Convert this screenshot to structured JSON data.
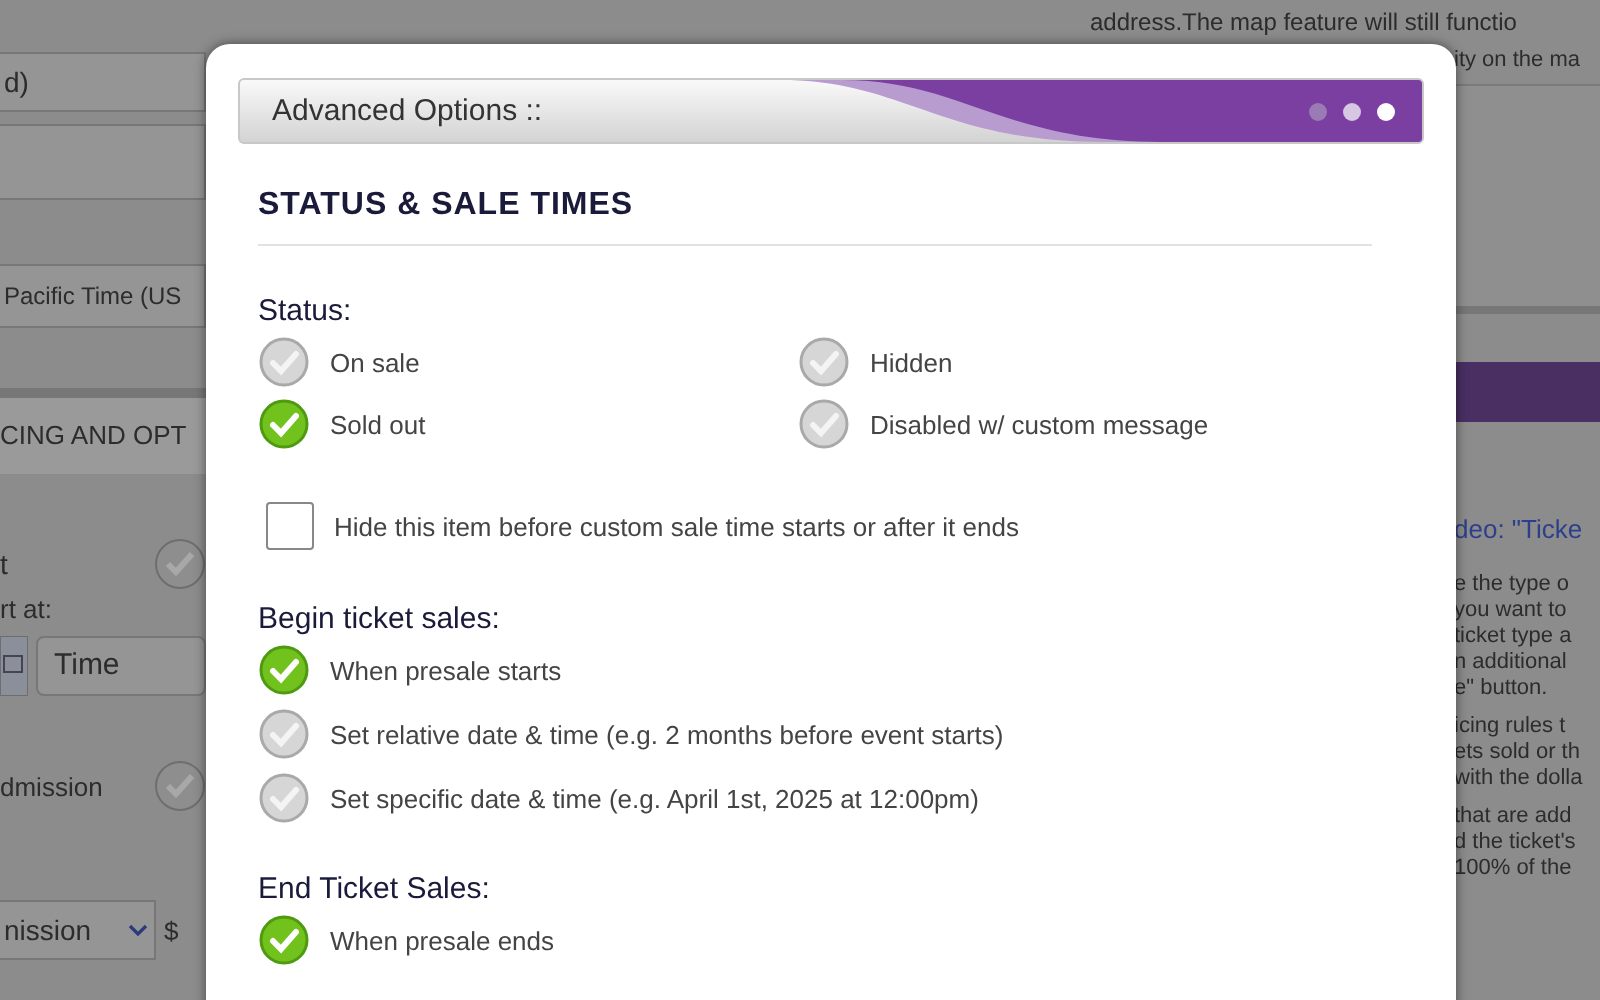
{
  "background": {
    "left": {
      "field_1": "d)",
      "timezone": "Pacific Time (US",
      "section_header": "CING AND OPT",
      "option_1": {
        "label": "t",
        "selected": false
      },
      "start_label": "rt at:",
      "time_field": "Time",
      "option_2": {
        "label": "dmission",
        "selected": false
      },
      "type_select": "nission",
      "currency": "$"
    },
    "right": {
      "top_text": [
        "address.The map feature will still functio"
      ],
      "top_text_tail": "ity on the ma",
      "video_link": "deo: \"Ticke",
      "help_paragraphs": [
        [
          "e the type o",
          "you want to",
          "ticket type a",
          "n additional",
          "e\" button."
        ],
        [
          "icing rules t",
          "ets sold or th",
          "with the dolla"
        ],
        [
          "that are add",
          "d the ticket's",
          "100% of the"
        ]
      ]
    }
  },
  "modal": {
    "title": "Advanced Options ::",
    "heading": "STATUS & SALE TIMES",
    "status": {
      "label": "Status:",
      "options": [
        {
          "label": "On sale",
          "selected": false
        },
        {
          "label": "Hidden",
          "selected": false
        },
        {
          "label": "Sold out",
          "selected": true
        },
        {
          "label": "Disabled w/ custom message",
          "selected": false
        }
      ]
    },
    "hide_checkbox": {
      "label": "Hide this item before custom sale time starts or after it ends",
      "checked": false
    },
    "begin_sales": {
      "label": "Begin ticket sales:",
      "options": [
        {
          "label": "When presale starts",
          "selected": true
        },
        {
          "label": "Set relative date & time (e.g. 2 months before event starts)",
          "selected": false
        },
        {
          "label": "Set specific date & time (e.g. April 1st, 2025 at 12:00pm)",
          "selected": false
        }
      ]
    },
    "end_sales": {
      "label": "End Ticket Sales:",
      "options": [
        {
          "label": "When presale ends",
          "selected": true
        }
      ]
    }
  }
}
